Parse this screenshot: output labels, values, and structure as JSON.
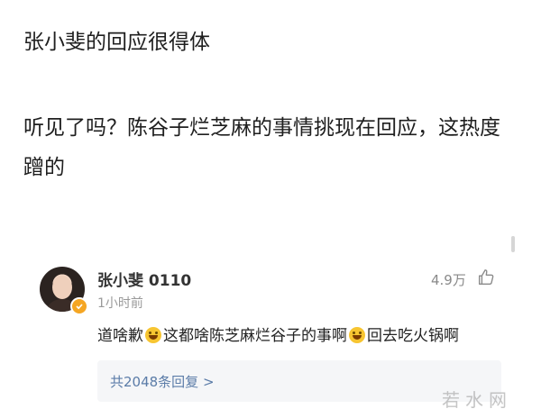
{
  "post": {
    "caption": "张小斐的回应很得体",
    "body": "听见了吗？陈谷子烂芝麻的事情挑现在回应，这热度蹭的"
  },
  "comment": {
    "username": "张小斐 0110",
    "timestamp": "1小时前",
    "like_count": "4.9万",
    "text_part1": "道啥歉",
    "text_part2": "这都啥陈芝麻烂谷子的事啊",
    "text_part3": "回去吃火锅啊",
    "replies_label": "共2048条回复 >"
  },
  "icons": {
    "like": "thumbs-up-icon",
    "verified": "verified-badge-icon",
    "emoji1": "cry-laugh-emoji",
    "emoji2": "laugh-emoji"
  },
  "colors": {
    "verified_badge": "#f5a623",
    "reply_link": "#5b7ca8",
    "reply_box_bg": "#f5f6f8"
  },
  "watermark": "若水网"
}
